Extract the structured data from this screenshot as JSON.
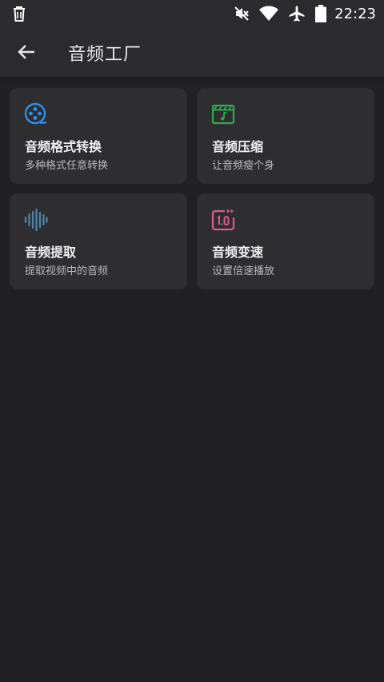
{
  "status_bar": {
    "time": "22:23",
    "icons": [
      "trash-icon",
      "mute-icon",
      "wifi-icon",
      "airplane-icon",
      "battery-icon"
    ]
  },
  "app_bar": {
    "back_icon": "arrow-left-icon",
    "title": "音频工厂"
  },
  "cards": [
    {
      "title": "音频格式转换",
      "subtitle": "多种格式任意转换",
      "icon": "film-reel-icon",
      "icon_color": "#2f8ee6"
    },
    {
      "title": "音频压缩",
      "subtitle": "让音频瘦个身",
      "icon": "music-clapper-icon",
      "icon_color": "#2fa84f"
    },
    {
      "title": "音频提取",
      "subtitle": "提取视频中的音频",
      "icon": "waveform-icon",
      "icon_color": "#4e86a8"
    },
    {
      "title": "音频变速",
      "subtitle": "设置倍速播放",
      "icon": "speed-1-0-icon",
      "icon_color": "#e05a8a"
    }
  ],
  "colors": {
    "background": "#212023",
    "bar": "#2b2a2d",
    "card": "#2e2d30"
  }
}
